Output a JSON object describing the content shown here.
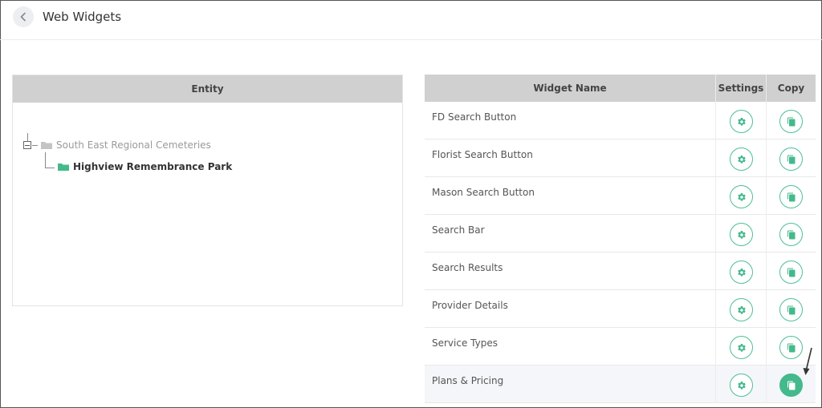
{
  "header": {
    "title": "Web Widgets"
  },
  "entity_panel": {
    "heading": "Entity",
    "tree": {
      "root_label": "South East Regional Cemeteries",
      "child_label": "Highview Remembrance Park"
    }
  },
  "widgets_table": {
    "columns": {
      "name": "Widget Name",
      "settings": "Settings",
      "copy": "Copy"
    },
    "rows": [
      {
        "name": "FD Search Button"
      },
      {
        "name": "Florist Search Button"
      },
      {
        "name": "Mason Search Button"
      },
      {
        "name": "Search Bar"
      },
      {
        "name": "Search Results"
      },
      {
        "name": "Provider Details"
      },
      {
        "name": "Service Types"
      },
      {
        "name": "Plans & Pricing"
      }
    ]
  },
  "colors": {
    "accent_green": "#43b98c",
    "header_gray": "#d0d0d0",
    "folder_gray": "#c4c4c4"
  },
  "icons": {
    "back": "chevron-left-icon",
    "settings": "gear-icon",
    "copy": "copy-icon",
    "folder": "folder-icon"
  }
}
